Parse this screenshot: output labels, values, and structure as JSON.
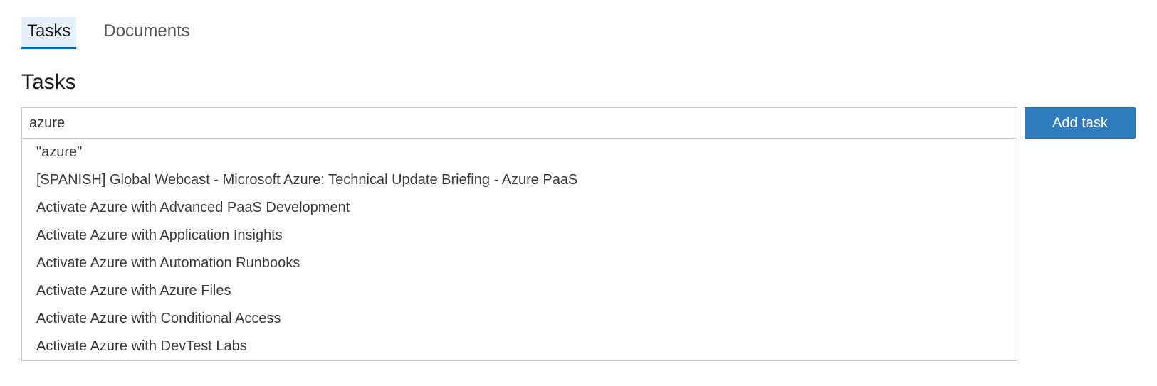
{
  "tabs": {
    "items": [
      {
        "label": "Tasks",
        "active": true
      },
      {
        "label": "Documents",
        "active": false
      }
    ]
  },
  "heading": "Tasks",
  "search": {
    "value": "azure",
    "placeholder": ""
  },
  "add_button_label": "Add task",
  "suggestions": [
    "\"azure\"",
    "[SPANISH] Global Webcast - Microsoft Azure: Technical Update Briefing - Azure PaaS",
    "Activate Azure with Advanced PaaS Development",
    "Activate Azure with Application Insights",
    "Activate Azure with Automation Runbooks",
    "Activate Azure with Azure Files",
    "Activate Azure with Conditional Access",
    "Activate Azure with DevTest Labs"
  ]
}
